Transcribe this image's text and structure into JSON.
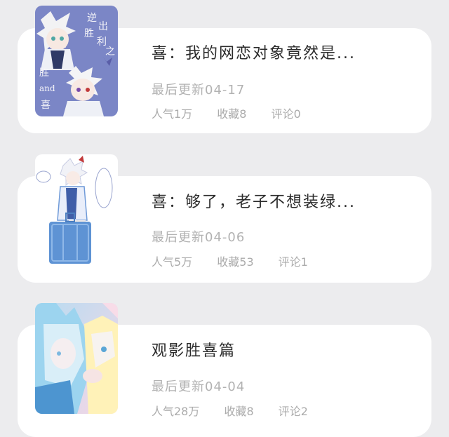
{
  "items": [
    {
      "title": "喜：我的网恋对象竟然是...",
      "updated": "最后更新04-17",
      "popularity": "人气1万",
      "favorites": "收藏8",
      "comments": "评论0",
      "cover_text": [
        "逆",
        "出",
        "胜",
        "利",
        "之",
        "胜",
        "and",
        "喜"
      ]
    },
    {
      "title": "喜：够了，老子不想装绿...",
      "updated": "最后更新04-06",
      "popularity": "人气5万",
      "favorites": "收藏53",
      "comments": "评论1"
    },
    {
      "title": "观影胜喜篇",
      "updated": "最后更新04-04",
      "popularity": "人气28万",
      "favorites": "收藏8",
      "comments": "评论2"
    }
  ]
}
